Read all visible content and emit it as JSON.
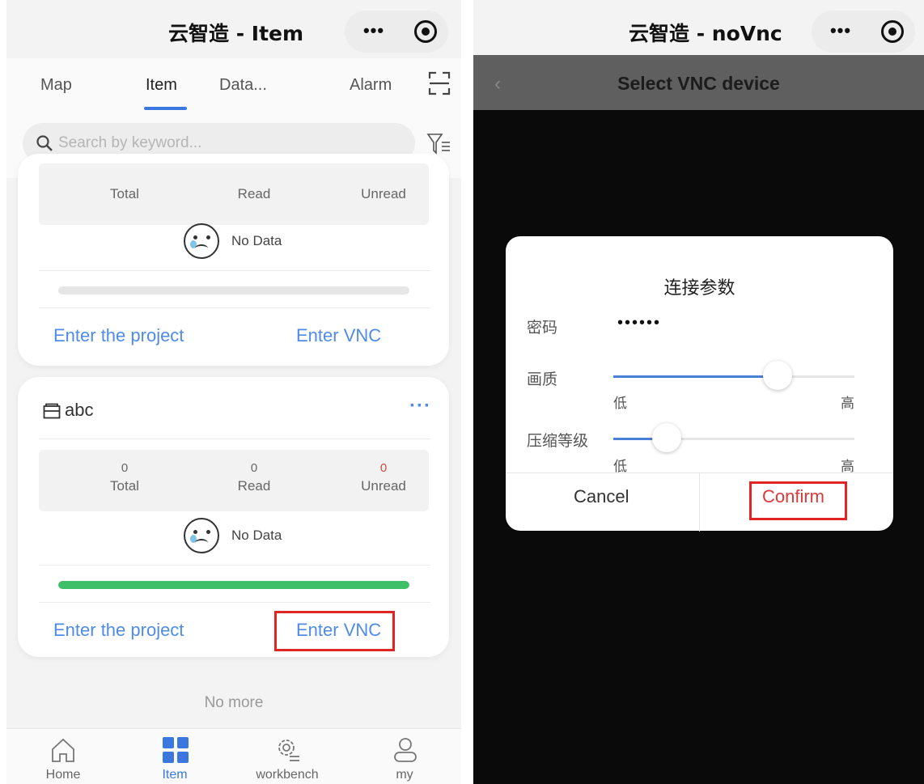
{
  "left": {
    "titlebar": {
      "title": "云智造 - Item",
      "more_icon": "ellipsis-icon",
      "close_icon": "target-icon"
    },
    "tabs": [
      {
        "label": "Map",
        "active": false
      },
      {
        "label": "Item",
        "active": true
      },
      {
        "label": "Data...",
        "active": false
      },
      {
        "label": "Alarm",
        "active": false
      }
    ],
    "scan_icon": "scan-icon",
    "search": {
      "placeholder": "Search by keyword...",
      "value": "",
      "filter_icon": "filter-icon"
    },
    "card1": {
      "stats": {
        "total_label": "Total",
        "read_label": "Read",
        "unread_label": "Unread"
      },
      "no_data": "No Data",
      "progress": 0,
      "enter_project": "Enter the project",
      "enter_vnc": "Enter VNC"
    },
    "card2": {
      "name": "abc",
      "more": "···",
      "stats": {
        "total": "0",
        "total_label": "Total",
        "read": "0",
        "read_label": "Read",
        "unread": "0",
        "unread_label": "Unread"
      },
      "no_data": "No Data",
      "progress": 1.0,
      "enter_project": "Enter the project",
      "enter_vnc": "Enter VNC"
    },
    "no_more": "No more",
    "nav": [
      {
        "label": "Home",
        "icon": "home-icon",
        "active": false
      },
      {
        "label": "Item",
        "icon": "grid-icon",
        "active": true
      },
      {
        "label": "workbench",
        "icon": "workbench-gear-icon",
        "active": false
      },
      {
        "label": "my",
        "icon": "user-icon",
        "active": false
      }
    ]
  },
  "right": {
    "titlebar": {
      "title": "云智造 - noVnc"
    },
    "header": {
      "back": "‹",
      "title": "Select VNC device"
    },
    "dialog": {
      "title": "连接参数",
      "password_label": "密码",
      "password_value": "••••••",
      "quality_label": "画质",
      "quality_value": 0.68,
      "compression_label": "压缩等级",
      "compression_value": 0.22,
      "low": "低",
      "high": "高",
      "cancel": "Cancel",
      "confirm": "Confirm"
    }
  },
  "colors": {
    "accent": "#3a78e0",
    "link": "#4f8be8",
    "progress": "#3fbf68",
    "highlight_box": "#e12424",
    "unread": "#d24a3c"
  }
}
